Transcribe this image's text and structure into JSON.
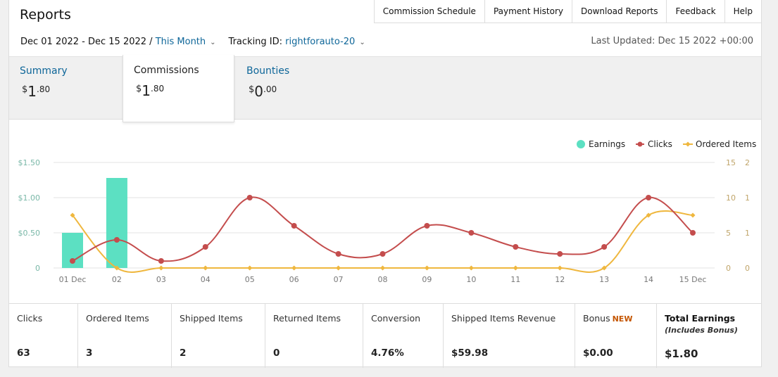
{
  "page": {
    "title": "Reports"
  },
  "topnav": [
    "Commission Schedule",
    "Payment History",
    "Download Reports",
    "Feedback",
    "Help"
  ],
  "filters": {
    "date_range": "Dec 01 2022 - Dec 15 2022 /",
    "period": "This Month",
    "tracking_label": "Tracking ID:",
    "tracking_id": "rightforauto-20",
    "last_updated": "Last Updated: Dec 15 2022 +00:00"
  },
  "tabs": {
    "summary": {
      "label": "Summary",
      "currency": "$",
      "whole": "1",
      "cents": ".80"
    },
    "commissions": {
      "label": "Commissions",
      "currency": "$",
      "whole": "1",
      "cents": ".80"
    },
    "bounties": {
      "label": "Bounties",
      "currency": "$",
      "whole": "0",
      "cents": ".00"
    }
  },
  "chart_data": {
    "type": "bar+line",
    "categories": [
      "01 Dec",
      "02",
      "03",
      "04",
      "05",
      "06",
      "07",
      "08",
      "09",
      "10",
      "11",
      "12",
      "13",
      "14",
      "15 Dec"
    ],
    "series": [
      {
        "name": "Earnings",
        "type": "bar",
        "axis": "left",
        "color": "#5ce0c2",
        "values": [
          0.5,
          1.28,
          0,
          0,
          0,
          0,
          0,
          0,
          0,
          0,
          0,
          0,
          0,
          0,
          0
        ]
      },
      {
        "name": "Clicks",
        "type": "line",
        "axis": "right1",
        "color": "#c44d4d",
        "values": [
          1,
          4,
          1,
          3,
          10,
          6,
          2,
          2,
          6,
          5,
          3,
          2,
          3,
          10,
          5
        ]
      },
      {
        "name": "Ordered Items",
        "type": "line",
        "axis": "right2",
        "color": "#efb73e",
        "values": [
          1,
          0,
          0,
          0,
          0,
          0,
          0,
          0,
          0,
          0,
          0,
          0,
          0,
          1,
          1
        ]
      }
    ],
    "y_left": {
      "ticks": [
        "0",
        "$0.50",
        "$1.00",
        "$1.50"
      ],
      "range": [
        0,
        1.5
      ]
    },
    "y_right1": {
      "ticks": [
        "0",
        "5",
        "10",
        "15"
      ],
      "range": [
        0,
        15
      ]
    },
    "y_right2": {
      "ticks": [
        "0",
        "1",
        "1",
        "2"
      ],
      "range": [
        0,
        2
      ]
    },
    "legend_position": "top-right",
    "grid": true
  },
  "metrics": [
    {
      "label": "Clicks",
      "value": "63"
    },
    {
      "label": "Ordered Items",
      "value": "3"
    },
    {
      "label": "Shipped Items",
      "value": "2"
    },
    {
      "label": "Returned Items",
      "value": "0"
    },
    {
      "label": "Conversion",
      "value": "4.76%"
    },
    {
      "label": "Shipped Items Revenue",
      "value": "$59.98"
    },
    {
      "label": "Bonus",
      "badge": "NEW",
      "value": "$0.00"
    },
    {
      "label": "Total Earnings",
      "sublabel": "(Includes Bonus)",
      "value": "$1.80"
    }
  ],
  "colors": {
    "link": "#0e6699",
    "earnings": "#5ce0c2",
    "clicks": "#c44d4d",
    "ordered": "#efb73e",
    "badge_new": "#c45500"
  }
}
